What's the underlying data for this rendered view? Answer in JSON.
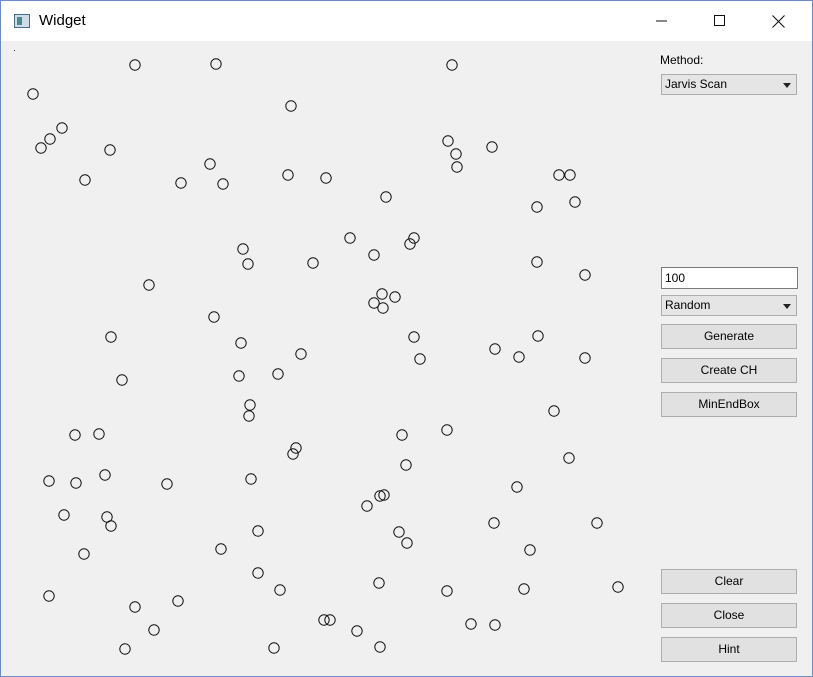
{
  "window": {
    "title": "Widget"
  },
  "titlebar": {
    "minimize_icon": "minimize-icon",
    "maximize_icon": "maximize-icon",
    "close_icon": "close-icon"
  },
  "side": {
    "method_label": "Method:",
    "method_value": "Jarvis Scan",
    "count_value": "100",
    "distribution_value": "Random",
    "buttons": {
      "generate": "Generate",
      "create_ch": "Create CH",
      "minendbox": "MinEndBox",
      "clear": "Clear",
      "close": "Close",
      "hint": "Hint"
    }
  }
}
